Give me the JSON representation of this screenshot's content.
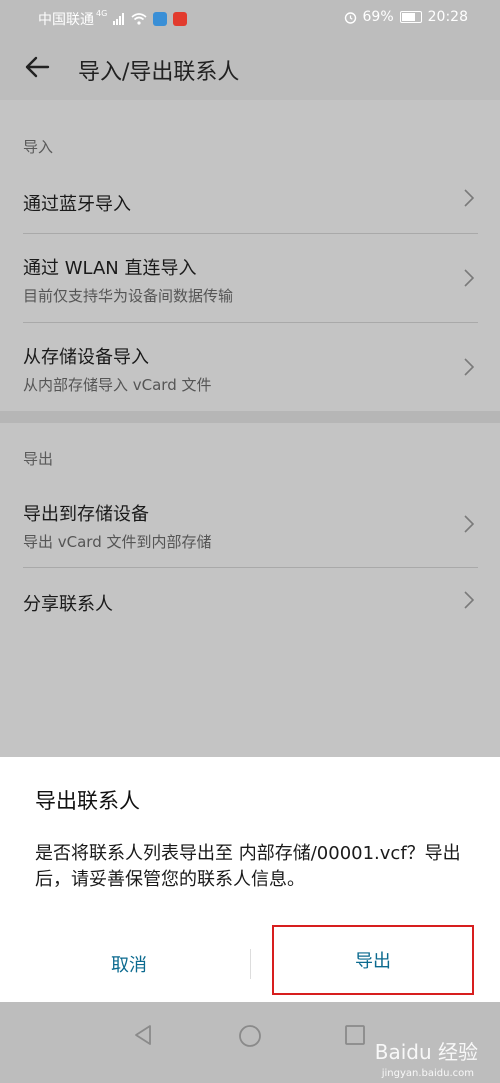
{
  "status": {
    "carrier": "中国联通",
    "network": "4G",
    "battery": "69%",
    "time": "20:28"
  },
  "header": {
    "title": "导入/导出联系人"
  },
  "import_section": {
    "header": "导入",
    "items": [
      {
        "title": "通过蓝牙导入",
        "subtitle": ""
      },
      {
        "title": "通过 WLAN 直连导入",
        "subtitle": "目前仅支持华为设备间数据传输"
      },
      {
        "title": "从存储设备导入",
        "subtitle": "从内部存储导入 vCard 文件"
      }
    ]
  },
  "export_section": {
    "header": "导出",
    "items": [
      {
        "title": "导出到存储设备",
        "subtitle": "导出 vCard 文件到内部存储"
      },
      {
        "title": "分享联系人",
        "subtitle": ""
      }
    ]
  },
  "dialog": {
    "title": "导出联系人",
    "message": "是否将联系人列表导出至 内部存储/00001.vcf？导出后，请妥善保管您的联系人信息。",
    "cancel_label": "取消",
    "export_label": "导出"
  },
  "watermark": {
    "text": "Baidu 经验",
    "sub": "jingyan.baidu.com"
  },
  "colors": {
    "accent": "#0b6a8f",
    "highlight_border": "#d71e1e"
  }
}
